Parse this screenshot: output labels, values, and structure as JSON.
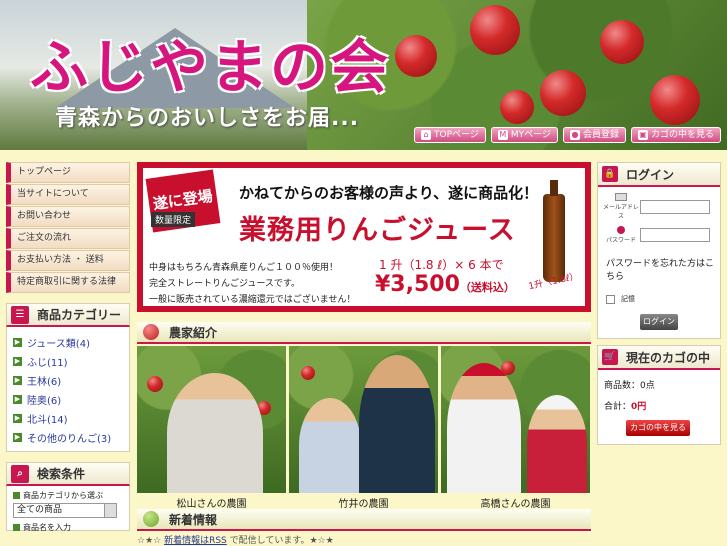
{
  "header": {
    "site_title": "ふじやまの会",
    "subtitle": "青森からのおいしさをお届..."
  },
  "topnav": [
    {
      "label": "TOPページ",
      "icon": "home-icon"
    },
    {
      "label": "MYページ",
      "icon": "my-page-icon"
    },
    {
      "label": "会員登録",
      "icon": "person-icon"
    },
    {
      "label": "カゴの中を見る",
      "icon": "cart-icon"
    }
  ],
  "side_menu": [
    "トップページ",
    "当サイトについて",
    "お問い合わせ",
    "ご注文の流れ",
    "お支払い方法 ・ 送料",
    "特定商取引に関する法律"
  ],
  "categories": {
    "title": "商品カテゴリー",
    "items": [
      "ジュース類(4)",
      "ふじ(11)",
      "王林(6)",
      "陸奥(6)",
      "北斗(14)",
      "その他のりんご(3)"
    ]
  },
  "search": {
    "title": "検索条件",
    "category_label": "商品カテゴリから選ぶ",
    "category_value": "全ての商品",
    "name_label": "商品名を入力"
  },
  "banner": {
    "tag": "遂に登場",
    "limited": "数量限定",
    "headline": "かねてからのお客様の声より、遂に商品化！",
    "main": "業務用りんごジュース",
    "body": [
      "中身はもちろん青森県産りんご１００％使用！",
      "完全ストレートりんごジュースです。",
      "一般に販売されている濃縮還元ではございません！"
    ],
    "qty": "1 升（1.8 ℓ）× 6 本で",
    "price": "¥3,500",
    "price_note": "（送料込）",
    "bottle_label": "1升（1.8ℓ）"
  },
  "farmers": {
    "title": "農家紹介",
    "captions": [
      "松山さんの農園",
      "竹井の農園",
      "高橋さんの農園"
    ]
  },
  "news": {
    "title": "新着情報",
    "line_prefix": "☆★☆",
    "link": "新着情報はRSS",
    "line_rest": "で配信しています。★☆★"
  },
  "login": {
    "title": "ログイン",
    "email_label": "メールアドレス",
    "password_label": "パスワード",
    "note": "パスワードを忘れた方はこちら",
    "remember": "記憶",
    "button": "ログイン"
  },
  "cart": {
    "title": "現在のカゴの中",
    "count_label": "商品数：",
    "count_value": "0点",
    "total_label": "合計：",
    "total_value": "0円",
    "button": "カゴの中を見る"
  },
  "colors": {
    "accent": "#c8174f",
    "background": "#fbf7c9",
    "banner_red": "#c8102e"
  }
}
